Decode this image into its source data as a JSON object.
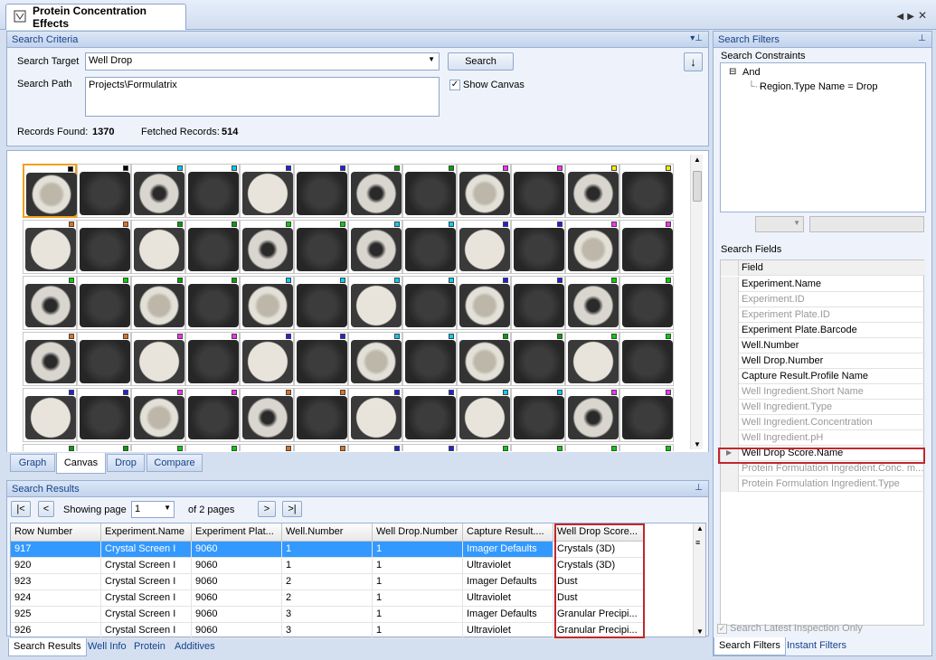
{
  "document_tab": {
    "title": "Protein Concentration Effects"
  },
  "search_criteria": {
    "header": "Search Criteria",
    "search_target_label": "Search Target",
    "search_target_value": "Well Drop",
    "search_path_label": "Search Path",
    "search_path_value": "Projects\\Formulatrix",
    "search_button": "Search",
    "show_canvas_label": "Show Canvas",
    "show_canvas_checked": true,
    "records_found_label": "Records Found:",
    "records_found_value": "1370",
    "fetched_records_label": "Fetched Records:",
    "fetched_records_value": "514"
  },
  "view_tabs": [
    "Graph",
    "Canvas",
    "Drop",
    "Compare"
  ],
  "view_tab_active": "Canvas",
  "search_results": {
    "header": "Search Results",
    "showing_page_label": "Showing page",
    "page_value": "1",
    "of_pages": "of 2 pages",
    "columns": [
      "Row Number",
      "Experiment.Name",
      "Experiment Plat...",
      "Well.Number",
      "Well Drop.Number",
      "Capture Result....",
      "Well Drop Score..."
    ],
    "rows": [
      [
        "917",
        "Crystal Screen I",
        "9060",
        "1",
        "1",
        "Imager Defaults",
        "Crystals (3D)"
      ],
      [
        "920",
        "Crystal Screen I",
        "9060",
        "1",
        "1",
        "Ultraviolet",
        "Crystals (3D)"
      ],
      [
        "923",
        "Crystal Screen I",
        "9060",
        "2",
        "1",
        "Imager Defaults",
        "Dust"
      ],
      [
        "924",
        "Crystal Screen I",
        "9060",
        "2",
        "1",
        "Ultraviolet",
        "Dust"
      ],
      [
        "925",
        "Crystal Screen I",
        "9060",
        "3",
        "1",
        "Imager Defaults",
        "Granular Precipi..."
      ],
      [
        "926",
        "Crystal Screen I",
        "9060",
        "3",
        "1",
        "Ultraviolet",
        "Granular Precipi..."
      ]
    ]
  },
  "bottom_tabs": [
    "Search Results",
    "Well Info",
    "Protein",
    "Additives"
  ],
  "search_filters": {
    "header": "Search Filters",
    "constraints_label": "Search Constraints",
    "tree_root": "And",
    "tree_child": "Region.Type Name = Drop",
    "fields_label": "Search Fields",
    "field_column": "Field",
    "fields": [
      {
        "name": "Experiment.Name",
        "enabled": true
      },
      {
        "name": "Experiment.ID",
        "enabled": false
      },
      {
        "name": "Experiment Plate.ID",
        "enabled": false
      },
      {
        "name": "Experiment Plate.Barcode",
        "enabled": true
      },
      {
        "name": "Well.Number",
        "enabled": true
      },
      {
        "name": "Well Drop.Number",
        "enabled": true
      },
      {
        "name": "Capture Result.Profile Name",
        "enabled": true
      },
      {
        "name": "Well Ingredient.Short Name",
        "enabled": false
      },
      {
        "name": "Well Ingredient.Type",
        "enabled": false
      },
      {
        "name": "Well Ingredient.Concentration",
        "enabled": false
      },
      {
        "name": "Well Ingredient.pH",
        "enabled": false
      },
      {
        "name": "Well Drop Score.Name",
        "enabled": true
      },
      {
        "name": "Protein Formulation Ingredient.Conc. m...",
        "enabled": false
      },
      {
        "name": "Protein Formulation Ingredient.Type",
        "enabled": false
      }
    ],
    "search_latest_label": "Search Latest Inspection Only",
    "tabs": [
      "Search Filters",
      "Instant Filters"
    ]
  },
  "colors": {
    "accent": "#15428b",
    "selection": "#3399ff",
    "highlight_box": "#c0272d"
  },
  "canvas_well_tags": [
    [
      "#000000",
      "#000000",
      "#00c8ff",
      "#00c8ff",
      "#2020e0",
      "#2020e0",
      "#00a000",
      "#00a000",
      "#ff30ff",
      "#ff30ff",
      "#ffee00",
      "#ffee00"
    ],
    [
      "#e07020",
      "#e07020",
      "#00a000",
      "#00a000",
      "#00d000",
      "#00d000",
      "#00d0ff",
      "#00d0ff",
      "#2020e0",
      "#2020e0",
      "#ff30ff",
      "#ff30ff"
    ],
    [
      "#00d000",
      "#00d000",
      "#00a000",
      "#00a000",
      "#00d0ff",
      "#00d0ff",
      "#00d0ff",
      "#00d0ff",
      "#2020e0",
      "#2020e0",
      "#00d000",
      "#00d000"
    ],
    [
      "#e07020",
      "#e07020",
      "#ff30ff",
      "#ff30ff",
      "#2020e0",
      "#2020e0",
      "#00d0ff",
      "#00d0ff",
      "#00a000",
      "#00a000",
      "#00d000",
      "#00d000"
    ],
    [
      "#2020e0",
      "#2020e0",
      "#ff30ff",
      "#ff30ff",
      "#e07020",
      "#e07020",
      "#2020e0",
      "#2020e0",
      "#00d0ff",
      "#00d0ff",
      "#ff30ff",
      "#ff30ff"
    ],
    [
      "#00a000",
      "#00a000",
      "#00d000",
      "#00d000",
      "#e07020",
      "#e07020",
      "#2020e0",
      "#2020e0",
      "#00d000",
      "#00d000",
      "#00d000",
      "#00d000"
    ]
  ]
}
